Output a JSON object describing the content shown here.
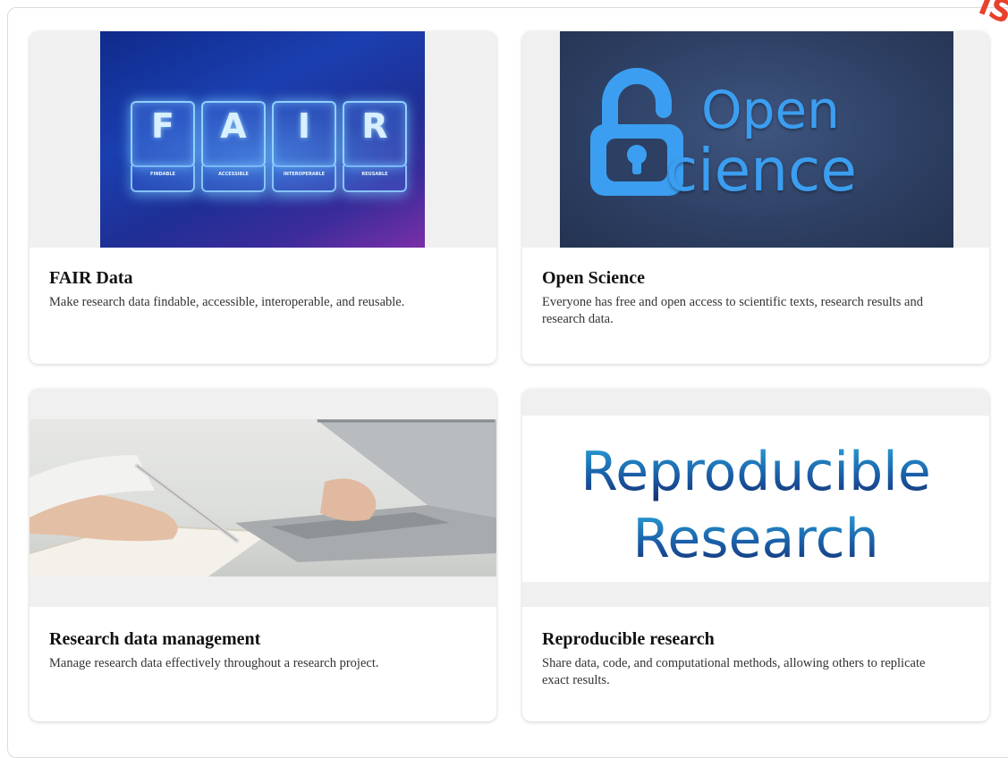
{
  "cards": [
    {
      "title": "FAIR Data",
      "description": "Make research data findable, accessible, interoperable, and reusable.",
      "image": {
        "letters": [
          "F",
          "A",
          "I",
          "R"
        ],
        "sublabels": [
          "FINDABLE",
          "ACCESSIBLE",
          "INTEROPERABLE",
          "REUSABLE"
        ]
      }
    },
    {
      "title": "Open Science",
      "description": "Everyone has free and open access to scientific texts, research results and research data.",
      "image": {
        "line1": "Open",
        "line2": "cience",
        "icon": "open-padlock-icon"
      }
    },
    {
      "title": "Research data management",
      "description": "Manage research data effectively throughout a research project."
    },
    {
      "title": "Reproducible research",
      "description": "Share data, code, and computational methods, allowing others to replicate exact results.",
      "image": {
        "line1": "Reproducible",
        "line2": "Research"
      }
    }
  ],
  "watermark": "iS"
}
